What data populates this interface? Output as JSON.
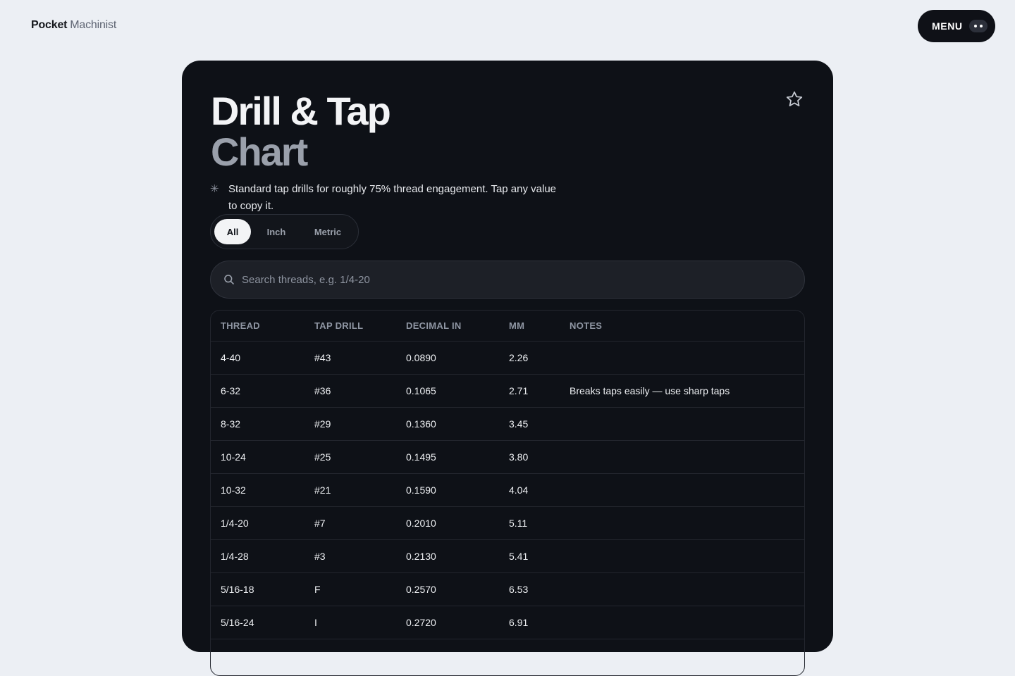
{
  "brand": {
    "name_bold": "Pocket",
    "name_light": "Machinist"
  },
  "menu": {
    "label": "MENU"
  },
  "page": {
    "title_line1": "Drill & Tap",
    "title_line2": "Chart",
    "description": "Standard tap drills for roughly 75% thread engagement. Tap any value to copy it."
  },
  "filters": {
    "options": [
      "All",
      "Inch",
      "Metric"
    ],
    "selected": "All"
  },
  "search": {
    "placeholder": "Search threads, e.g. 1/4-20",
    "value": ""
  },
  "table": {
    "columns": [
      "THREAD",
      "TAP DRILL",
      "DECIMAL IN",
      "MM",
      "NOTES"
    ],
    "rows": [
      [
        "4-40",
        "#43",
        "0.0890",
        "2.26",
        ""
      ],
      [
        "6-32",
        "#36",
        "0.1065",
        "2.71",
        "Breaks taps easily — use sharp taps"
      ],
      [
        "8-32",
        "#29",
        "0.1360",
        "3.45",
        ""
      ],
      [
        "10-24",
        "#25",
        "0.1495",
        "3.80",
        ""
      ],
      [
        "10-32",
        "#21",
        "0.1590",
        "4.04",
        ""
      ],
      [
        "1/4-20",
        "#7",
        "0.2010",
        "5.11",
        ""
      ],
      [
        "1/4-28",
        "#3",
        "0.2130",
        "5.41",
        ""
      ],
      [
        "5/16-18",
        "F",
        "0.2570",
        "6.53",
        ""
      ],
      [
        "5/16-24",
        "I",
        "0.2720",
        "6.91",
        ""
      ]
    ]
  },
  "icons": {
    "favorite": "star-icon",
    "search": "search-icon",
    "menu": "more-dots-icon",
    "description": "sparkle-icon"
  },
  "colors": {
    "card_bg": "#0e1117",
    "page_bg": "#eceff4",
    "accent_text": "#9aa0ab"
  }
}
